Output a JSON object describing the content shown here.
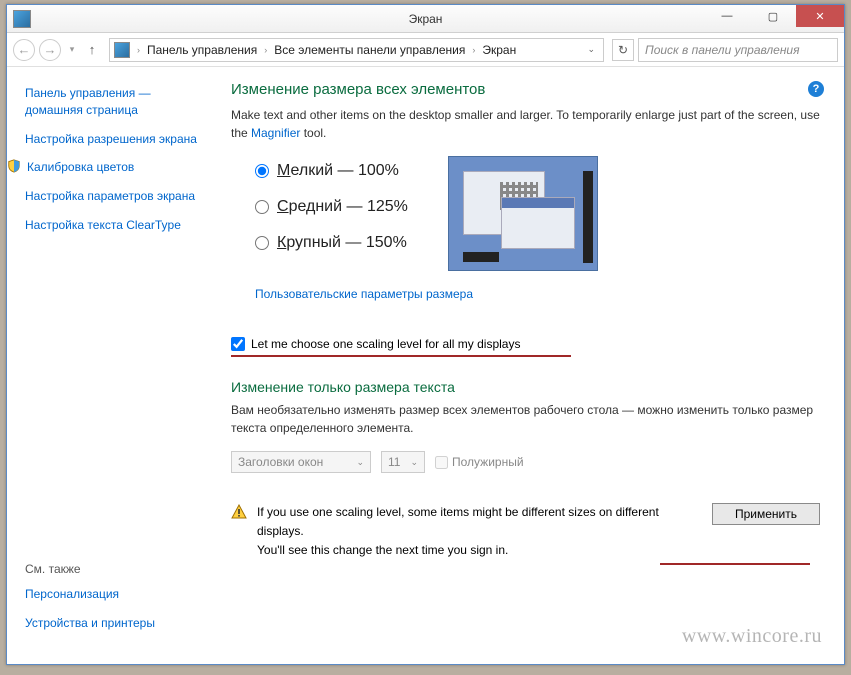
{
  "window": {
    "title": "Экран"
  },
  "nav": {
    "breadcrumbs": [
      "Панель управления",
      "Все элементы панели управления",
      "Экран"
    ],
    "search_placeholder": "Поиск в панели управления"
  },
  "sidebar": {
    "links": [
      "Панель управления — домашняя страница",
      "Настройка разрешения экрана",
      "Калибровка цветов",
      "Настройка параметров экрана",
      "Настройка текста ClearType"
    ],
    "see_also_heading": "См. также",
    "see_also": [
      "Персонализация",
      "Устройства и принтеры"
    ]
  },
  "main": {
    "heading1": "Изменение размера всех элементов",
    "desc_prefix": "Make text and other items on the desktop smaller and larger. To temporarily enlarge just part of the screen, use the ",
    "magnifier_link": "Magnifier",
    "desc_suffix": " tool.",
    "radios": [
      {
        "letter": "М",
        "rest": "елкий",
        "pct": "100%",
        "checked": true
      },
      {
        "letter": "С",
        "rest": "редний",
        "pct": "125%",
        "checked": false
      },
      {
        "letter": "К",
        "rest": "рупный",
        "pct": "150%",
        "checked": false
      }
    ],
    "custom_link": "Пользовательские параметры размера",
    "checkbox_label": "Let me choose one scaling level for all my displays",
    "checkbox_checked": true,
    "heading2": "Изменение только размера текста",
    "desc2": "Вам необязательно изменять размер всех элементов рабочего стола — можно изменить только размер текста определенного элемента.",
    "combo_element": "Заголовки окон",
    "combo_size": "11",
    "bold_label": "Полужирный",
    "warning1": "If you use one scaling level, some items might be different sizes on different displays.",
    "warning2": "You'll see this change the next time you sign in.",
    "apply_label": "Применить"
  },
  "watermark": "www.wincore.ru"
}
